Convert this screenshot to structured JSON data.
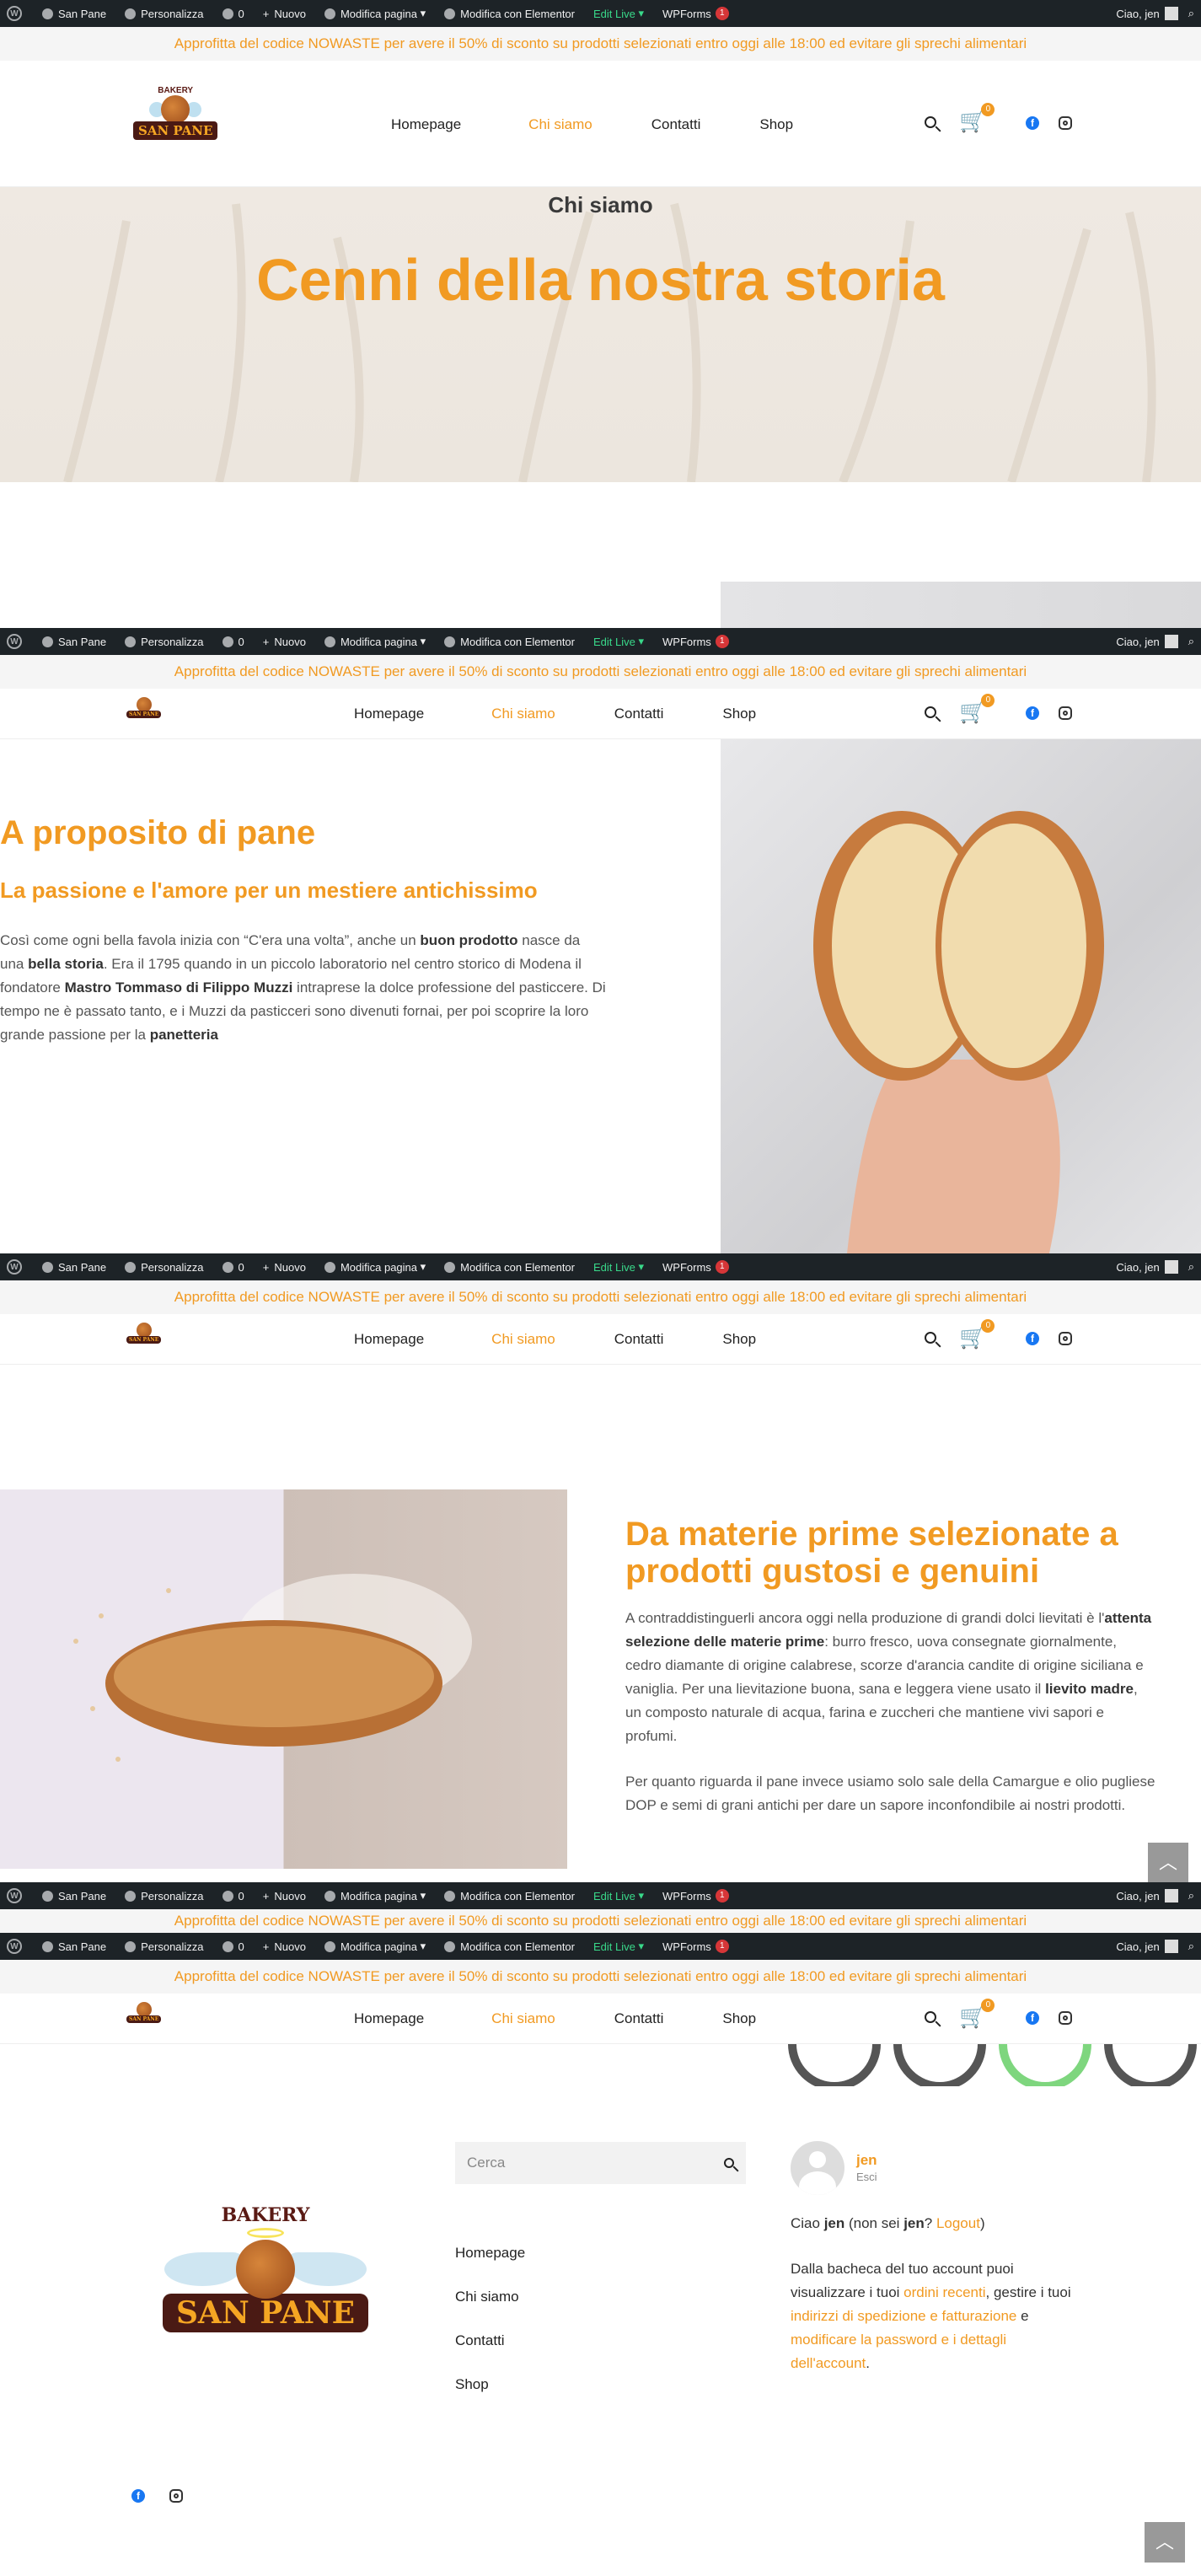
{
  "admin_bar": {
    "site": "San Pane",
    "customize": "Personalizza",
    "comments": "0",
    "new": "Nuovo",
    "edit_page": "Modifica pagina",
    "elementor": "Modifica con Elementor",
    "edit_live": "Edit Live",
    "wpforms": "WPForms",
    "wpforms_badge": "1",
    "greeting": "Ciao, jen"
  },
  "promo": {
    "text": "Approfitta del codice NOWASTE per avere il 50% di sconto su prodotti selezionati entro oggi alle 18:00 ed evitare gli sprechi alimentari"
  },
  "logo": {
    "top": "BAKERY",
    "name": "SAN PANE"
  },
  "nav": {
    "items": [
      "Homepage",
      "Chi siamo",
      "Contatti",
      "Shop"
    ],
    "active": "Chi siamo",
    "cart_count": "0"
  },
  "hero": {
    "kicker": "Chi siamo",
    "title": "Cenni della nostra storia"
  },
  "about": {
    "title": "A proposito di pane",
    "subtitle": "La passione e l'amore per un mestiere antichissimo",
    "p1": "Così come ogni bella favola inizia con “C'era una volta”, anche un ",
    "p1_b1": "buon prodotto",
    "p2": " nasce da una ",
    "p2_b": "bella storia",
    "p3": ". Era il 1795 quando in un piccolo laboratorio nel centro storico di Modena il fondatore ",
    "p3_b": "Mastro Tommaso di Filippo Muzzi",
    "p4": " intraprese la dolce professione del pasticcere. Di tempo ne è passato tanto, e i Muzzi da pasticceri sono divenuti fornai, per poi scoprire la loro grande passione per la ",
    "p4_b": "panetteria"
  },
  "materials": {
    "title": "Da materie prime selezionate a prodotti gustosi e genuini",
    "p1a": "A contraddistinguerli ancora oggi nella produzione di grandi dolci lievitati è l'",
    "p1b": "attenta selezione delle materie prime",
    "p1c": ": burro fresco, uova consegnate giornalmente, cedro diamante di origine calabrese, scorze d'arancia candite di origine siciliana e vaniglia. Per una lievitazione buona, sana e leggera viene usato il ",
    "p1d": "lievito madre",
    "p1e": ", un composto naturale di acqua, farina e zuccheri che mantiene vivi sapori e profumi.",
    "p2": "Per quanto riguarda il pane invece usiamo solo sale della Camargue e olio pugliese DOP e semi di grani antichi per dare un sapore inconfondibile ai nostri prodotti."
  },
  "footer": {
    "search_placeholder": "Cerca",
    "links": [
      "Homepage",
      "Chi siamo",
      "Contatti",
      "Shop"
    ],
    "user": "jen",
    "logout_small": "Esci",
    "hello_a": "Ciao ",
    "hello_user": "jen",
    "hello_b": " (non sei ",
    "hello_user2": "jen",
    "hello_c": "? ",
    "logout": "Logout",
    "hello_d": ")",
    "dash_a": "Dalla bacheca del tuo account puoi visualizzare i tuoi ",
    "dash_l1": "ordini recenti",
    "dash_b": ", gestire i tuoi ",
    "dash_l2": "indirizzi di spedizione e fatturazione",
    "dash_c": " e ",
    "dash_l3": "modificare la password e i dettagli dell'account",
    "dash_d": "."
  },
  "colors": {
    "accent": "#f19a22",
    "admin_bg": "#1d2327",
    "facebook": "#1877f2"
  }
}
